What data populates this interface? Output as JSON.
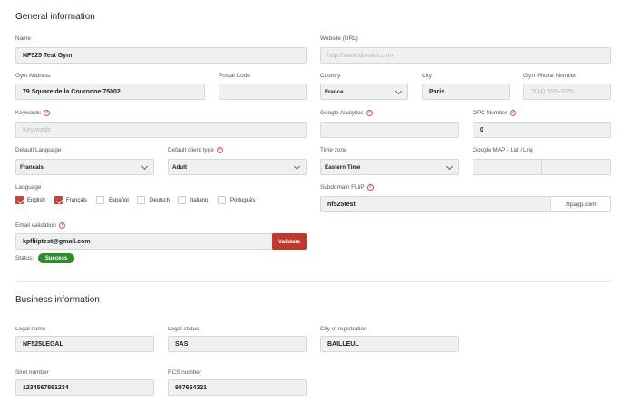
{
  "general": {
    "title": "General information",
    "name": {
      "label": "Name",
      "value": "NF525 Test Gym"
    },
    "website": {
      "label": "Website (URL)",
      "placeholder": "http://www.domain.com"
    },
    "address": {
      "label": "Gym Address",
      "value": "79 Square de la Couronne 75002"
    },
    "postal_code": {
      "label": "Postal Code",
      "value": ""
    },
    "country": {
      "label": "Country",
      "value": "France"
    },
    "city": {
      "label": "City",
      "value": "Paris"
    },
    "phone": {
      "label": "Gym Phone Number",
      "placeholder": "(514) 555-5555"
    },
    "keywords": {
      "label": "Keywords",
      "placeholder": "Keywords"
    },
    "google_analytics": {
      "label": "Google Analytics",
      "value": ""
    },
    "opc_number": {
      "label": "OPC Number",
      "value": "0"
    },
    "default_language": {
      "label": "Default Language",
      "value": "Français"
    },
    "default_client_type": {
      "label": "Default client type",
      "value": "Adult"
    },
    "time_zone": {
      "label": "Time zone",
      "value": "Eastern Time"
    },
    "google_map": {
      "label": "Google MAP - Lat / Lng",
      "lat": "",
      "lng": ""
    },
    "language": {
      "label": "Language",
      "options": [
        {
          "label": "English",
          "checked": true
        },
        {
          "label": "Français",
          "checked": true
        },
        {
          "label": "Español",
          "checked": false
        },
        {
          "label": "Deutsch",
          "checked": false
        },
        {
          "label": "Italiano",
          "checked": false
        },
        {
          "label": "Português",
          "checked": false
        }
      ]
    },
    "subdomain": {
      "label": "Subdomain FLiiP",
      "value": "nf525test",
      "suffix": ".flipapp.com"
    },
    "email_validation": {
      "label": "Email validation",
      "value": "kpfliiptest@gmail.com",
      "button": "Validate"
    },
    "status": {
      "label": "Status:",
      "value": "Success",
      "color": "#2e8b2e"
    },
    "help_glyph": "?"
  },
  "business": {
    "title": "Business information",
    "legal_name": {
      "label": "Legal name",
      "value": "NF525LEGAL"
    },
    "legal_status": {
      "label": "Legal status",
      "value": "SAS"
    },
    "city_registration": {
      "label": "City of registration",
      "value": "BAILLEUL"
    },
    "siret": {
      "label": "Siret number",
      "value": "1234567891234"
    },
    "rcs": {
      "label": "RCS number",
      "value": "987654321"
    }
  },
  "colors": {
    "accent": "#c0392b",
    "success": "#2e8b2e",
    "field_bg": "#eef0f1"
  }
}
